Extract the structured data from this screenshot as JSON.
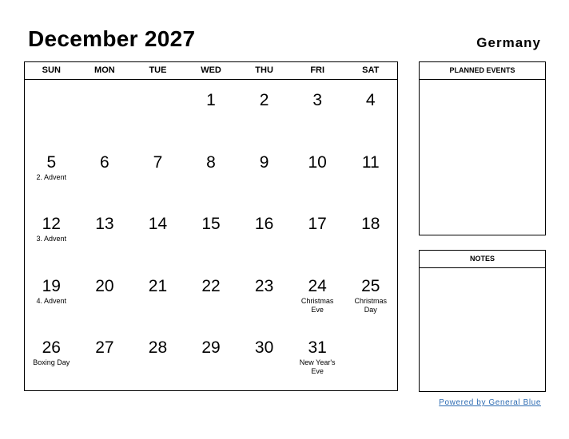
{
  "header": {
    "title": "December 2027",
    "country": "Germany"
  },
  "calendar": {
    "weekdays": [
      "SUN",
      "MON",
      "TUE",
      "WED",
      "THU",
      "FRI",
      "SAT"
    ],
    "weeks": [
      [
        {
          "d": ""
        },
        {
          "d": ""
        },
        {
          "d": ""
        },
        {
          "d": "1"
        },
        {
          "d": "2"
        },
        {
          "d": "3"
        },
        {
          "d": "4"
        }
      ],
      [
        {
          "d": "5",
          "h": "2. Advent"
        },
        {
          "d": "6"
        },
        {
          "d": "7"
        },
        {
          "d": "8"
        },
        {
          "d": "9"
        },
        {
          "d": "10"
        },
        {
          "d": "11"
        }
      ],
      [
        {
          "d": "12",
          "h": "3. Advent"
        },
        {
          "d": "13"
        },
        {
          "d": "14"
        },
        {
          "d": "15"
        },
        {
          "d": "16"
        },
        {
          "d": "17"
        },
        {
          "d": "18"
        }
      ],
      [
        {
          "d": "19",
          "h": "4. Advent"
        },
        {
          "d": "20"
        },
        {
          "d": "21"
        },
        {
          "d": "22"
        },
        {
          "d": "23"
        },
        {
          "d": "24",
          "h": "Christmas Eve"
        },
        {
          "d": "25",
          "h": "Christmas Day"
        }
      ],
      [
        {
          "d": "26",
          "h": "Boxing Day"
        },
        {
          "d": "27"
        },
        {
          "d": "28"
        },
        {
          "d": "29"
        },
        {
          "d": "30"
        },
        {
          "d": "31",
          "h": "New Year's Eve"
        },
        {
          "d": ""
        }
      ]
    ]
  },
  "panels": {
    "planned_events": "PLANNED EVENTS",
    "notes": "NOTES"
  },
  "footer": {
    "powered_by": "Powered by General Blue"
  }
}
